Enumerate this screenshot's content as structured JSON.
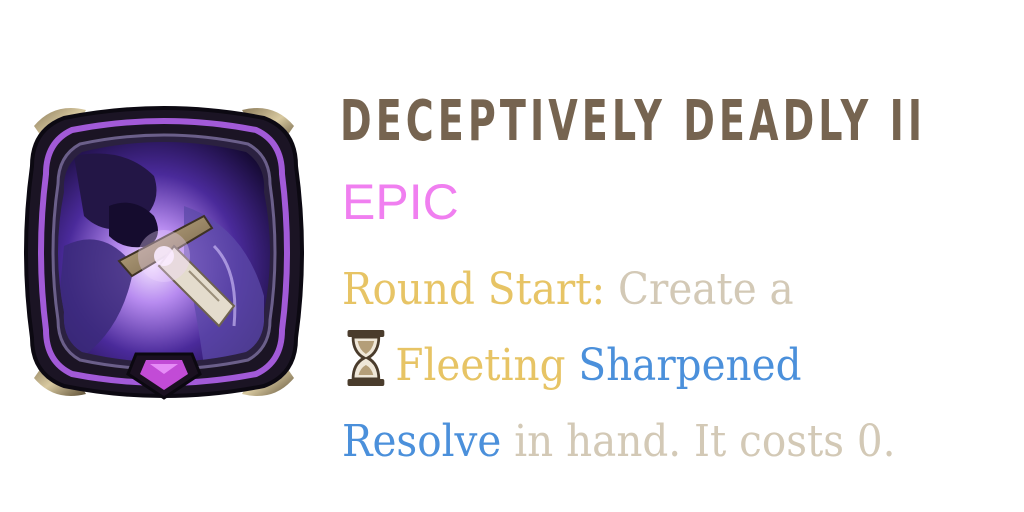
{
  "card": {
    "title": "DECEPTIVELY DEADLY II",
    "rarity": "EPIC",
    "description": {
      "line1": {
        "trigger": "Round Start:",
        "text": " Create a"
      },
      "line2": {
        "icon": "hourglass-icon",
        "keyword_fleeting": "Fleeting",
        "space": " ",
        "keyword_card": "Sharpened"
      },
      "line3": {
        "keyword_card": "Resolve",
        "text": " in hand. It costs 0."
      }
    },
    "icon": "dagger-hand-art",
    "colors": {
      "title": "#766450",
      "rarity": "#f07ff0",
      "keyword_gold": "#e7c465",
      "keyword_blue": "#4b90db",
      "body_text": "#d3c9b6",
      "frame_purple": "#a25ad8",
      "gem_pink": "#c24bd6"
    }
  }
}
